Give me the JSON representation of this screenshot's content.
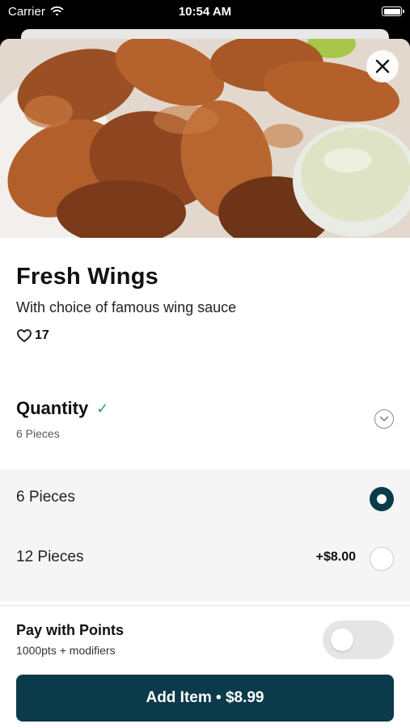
{
  "status_bar": {
    "carrier": "Carrier",
    "time": "10:54 AM",
    "icons": [
      "wifi-icon",
      "battery-icon"
    ]
  },
  "item": {
    "image_alt": "Fresh wings with dipping sauce",
    "title": "Fresh Wings",
    "description": "With choice of famous wing sauce",
    "likes": "17"
  },
  "quantity": {
    "title": "Quantity",
    "summary": "6 Pieces",
    "options": [
      {
        "label": "6 Pieces",
        "price": "",
        "selected": true
      },
      {
        "label": "12 Pieces",
        "price": "+$8.00",
        "selected": false
      }
    ]
  },
  "points": {
    "title": "Pay with Points",
    "subtitle": "1000pts + modifiers",
    "enabled": false
  },
  "add_button": {
    "label": "Add Item • $8.99"
  },
  "colors": {
    "primary": "#0b3a4a",
    "check": "#22a35a",
    "options_bg": "#f5f5f5",
    "toggle_off": "#e5e5e5"
  }
}
